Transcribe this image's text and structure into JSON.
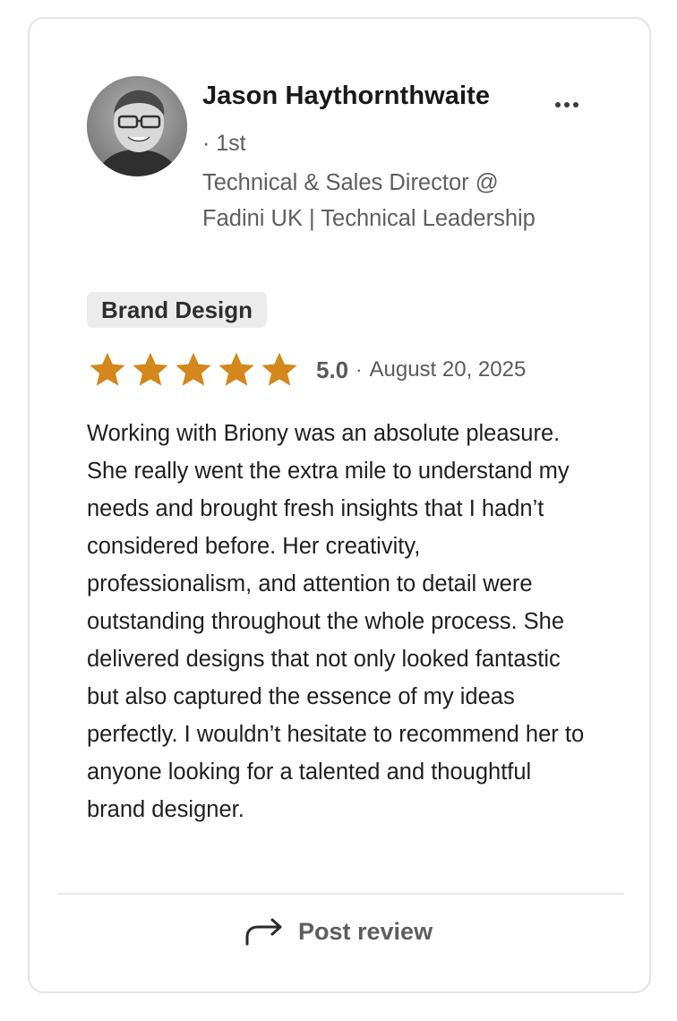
{
  "reviewer": {
    "name": "Jason Haythornthwaite",
    "degree": "· 1st",
    "headline": "Technical & Sales Director @ Fadini UK | Technical Leadership",
    "avatar_icon": "profile-photo"
  },
  "more_icon": "more-horizontal-icon",
  "skill_tag": "Brand Design",
  "rating": {
    "value": 5,
    "max": 5,
    "score_label": "5.0",
    "separator": "·",
    "date": "August 20, 2025",
    "star_color": "#D4871A"
  },
  "review_text": "Working with Briony was an absolute pleasure. She really went the extra mile to understand my needs and brought fresh insights that I hadn’t considered before. Her creativity, professionalism, and attention to detail were outstanding throughout the whole process. She delivered designs that not only looked fantastic but also captured the essence of my ideas perfectly. I wouldn’t hesitate to recommend her to anyone looking for a talented and thoughtful brand designer.",
  "footer": {
    "post_review_label": "Post review",
    "post_review_icon": "share-arrow-icon"
  }
}
